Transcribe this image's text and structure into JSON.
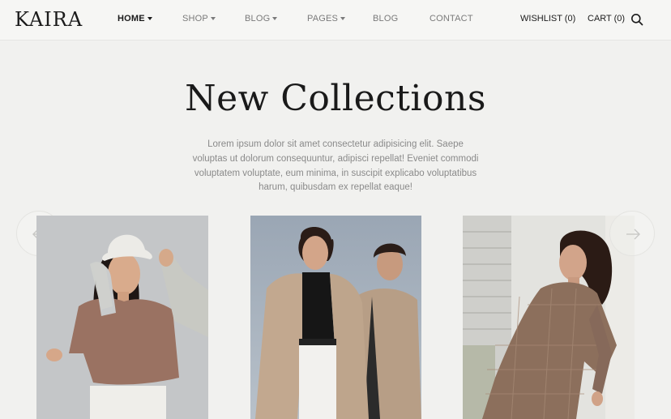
{
  "brand": {
    "logo": "KAIRA"
  },
  "nav": {
    "items": [
      {
        "label": "HOME",
        "dropdown": true,
        "active": true
      },
      {
        "label": "SHOP",
        "dropdown": true,
        "active": false
      },
      {
        "label": "BLOG",
        "dropdown": true,
        "active": false
      },
      {
        "label": "PAGES",
        "dropdown": true,
        "active": false
      },
      {
        "label": "BLOG",
        "dropdown": false,
        "active": false
      },
      {
        "label": "CONTACT",
        "dropdown": false,
        "active": false
      }
    ],
    "wishlist": "WISHLIST (0)",
    "cart": "CART (0)",
    "search_icon": "search-icon"
  },
  "hero": {
    "title": "New Collections",
    "description": "Lorem ipsum dolor sit amet consectetur adipisicing elit. Saepe voluptas ut dolorum consequuntur, adipisci repellat! Eveniet commodi voluptatem voluptate, eum minima, in suscipit explicabo voluptatibus harum, quibusdam ex repellat eaque!"
  },
  "carousel": {
    "prev_icon": "arrow-left-icon",
    "next_icon": "arrow-right-icon",
    "products": [
      {
        "image": "woman-white-bucket-hat-brown-top"
      },
      {
        "image": "two-women-beige-trench-coats"
      },
      {
        "image": "woman-plaid-oversized-blazer"
      }
    ]
  },
  "colors": {
    "background": "#f1f1ef",
    "text_dark": "#1a1a1a",
    "text_muted": "#8a8a8a"
  }
}
